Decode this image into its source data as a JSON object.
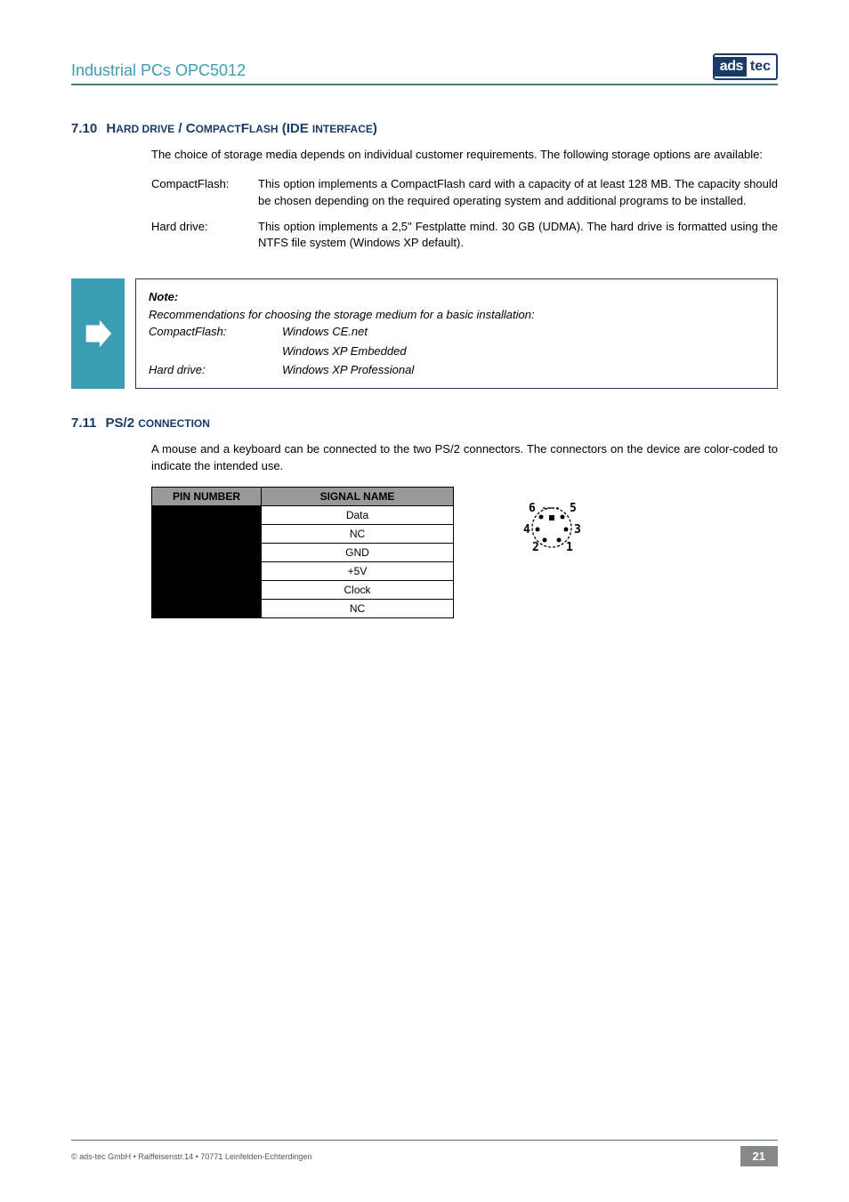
{
  "header": {
    "title": "Industrial PCs OPC5012",
    "logo_left": "ads",
    "logo_right": "tec"
  },
  "section1": {
    "number": "7.10",
    "title_a": "H",
    "title_b": "ARD DRIVE",
    "title_c": " / C",
    "title_d": "OMPACT",
    "title_e": "F",
    "title_f": "LASH",
    "title_g": " (IDE ",
    "title_h": "INTERFACE",
    "title_i": ")",
    "intro": "The choice of storage media depends on individual customer requirements. The following storage options are available:",
    "items": [
      {
        "term": "CompactFlash:",
        "desc": "This option implements a CompactFlash card with a capacity of at least 128 MB. The capacity should be chosen depending on the required operating system and additional programs to be installed."
      },
      {
        "term": "Hard drive:",
        "desc": "This option implements a 2,5\" Festplatte mind. 30 GB (UDMA). The hard drive is formatted using the NTFS file system (Windows XP default)."
      }
    ]
  },
  "note": {
    "title": "Note:",
    "line1": "Recommendations for choosing the storage medium for a basic installation:",
    "rows": [
      {
        "k": "CompactFlash:",
        "v": "Windows CE.net"
      },
      {
        "k": "",
        "v": "Windows XP Embedded"
      },
      {
        "k": "Hard drive:",
        "v": "Windows XP Professional"
      }
    ]
  },
  "section2": {
    "number": "7.11",
    "title_a": "PS/2 ",
    "title_b": "CONNECTION",
    "intro": "A mouse and a keyboard can be connected to the two PS/2 connectors. The connectors on the device are color-coded to indicate the intended use.",
    "table": {
      "h1": "PIN NUMBER",
      "h2": "SIGNAL NAME",
      "rows": [
        "Data",
        "NC",
        "GND",
        "+5V",
        "Clock",
        "NC"
      ]
    }
  },
  "footer": {
    "copyright": "© ads-tec GmbH • Raiffeisenstr.14 • 70771 Leinfelden-Echterdingen",
    "page": "21"
  }
}
